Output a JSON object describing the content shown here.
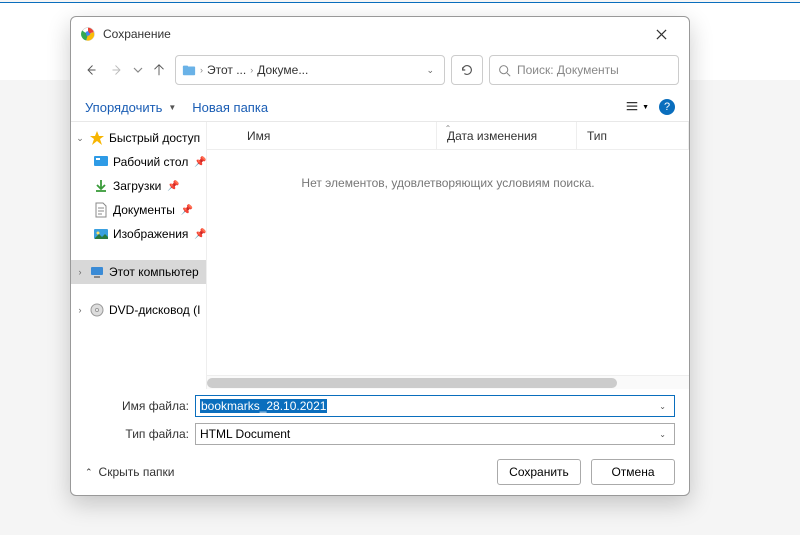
{
  "dialog": {
    "title": "Сохранение"
  },
  "breadcrumb": {
    "seg1": "Этот ...",
    "seg2": "Докуме..."
  },
  "search": {
    "placeholder": "Поиск: Документы"
  },
  "toolbar": {
    "organize": "Упорядочить",
    "new_folder": "Новая папка"
  },
  "sidebar": {
    "quick": "Быстрый доступ",
    "desktop": "Рабочий стол",
    "downloads": "Загрузки",
    "documents": "Документы",
    "pictures": "Изображения",
    "this_pc": "Этот компьютер",
    "dvd": "DVD-дисковод (I"
  },
  "columns": {
    "name": "Имя",
    "date": "Дата изменения",
    "type": "Тип"
  },
  "content": {
    "empty": "Нет элементов, удовлетворяющих условиям поиска."
  },
  "fields": {
    "filename_label": "Имя файла:",
    "filename_value": "bookmarks_28.10.2021",
    "filetype_label": "Тип файла:",
    "filetype_value": "HTML Document"
  },
  "actions": {
    "hide_folders": "Скрыть папки",
    "save": "Сохранить",
    "cancel": "Отмена"
  }
}
